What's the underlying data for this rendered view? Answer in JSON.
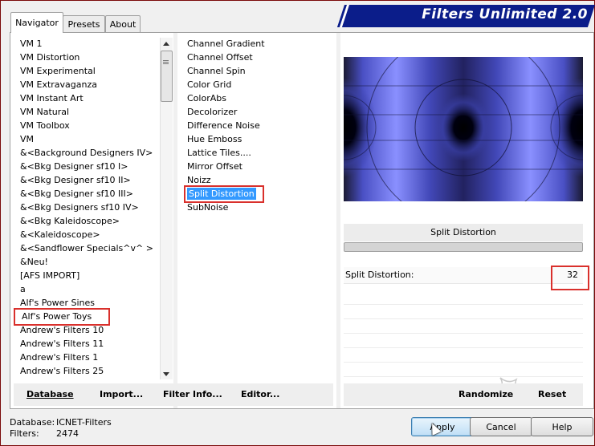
{
  "app": {
    "title": "Filters Unlimited 2.0",
    "brand_color": "#0b1d8a"
  },
  "tabs": [
    {
      "label": "Navigator",
      "active": true
    },
    {
      "label": "Presets",
      "active": false
    },
    {
      "label": "About",
      "active": false
    }
  ],
  "categories": {
    "items": [
      "VM 1",
      "VM Distortion",
      "VM Experimental",
      "VM Extravaganza",
      "VM Instant Art",
      "VM Natural",
      "VM Toolbox",
      "VM",
      "&<Background Designers IV>",
      "&<Bkg Designer sf10 I>",
      "&<Bkg Designer sf10 II>",
      "&<Bkg Designer sf10 III>",
      "&<Bkg Designers sf10 IV>",
      "&<Bkg Kaleidoscope>",
      "&<Kaleidoscope>",
      "&<Sandflower Specials^v^ >",
      "&Neu!",
      "[AFS IMPORT]",
      "a",
      "Alf's Power Sines",
      "Alf's Power Toys",
      "Andrew's Filters 10",
      "Andrew's Filters 11",
      "Andrew's Filters 1",
      "Andrew's Filters 25"
    ],
    "selected": "Alf's Power Toys"
  },
  "filters": {
    "items": [
      "Channel Gradient",
      "Channel Offset",
      "Channel Spin",
      "Color Grid",
      "ColorAbs",
      "Decolorizer",
      "Difference Noise",
      "Hue Emboss",
      "Lattice Tiles....",
      "Mirror Offset",
      "Noizz",
      "Split Distortion",
      "SubNoise"
    ],
    "selected": "Split Distortion"
  },
  "parameters": {
    "filter_name": "Split Distortion",
    "rows": [
      {
        "label": "Split Distortion:",
        "value": "32"
      }
    ]
  },
  "left_buttons": {
    "database": "Database",
    "import": "Import...",
    "filter_info": "Filter Info...",
    "editor": "Editor..."
  },
  "right_buttons": {
    "randomize": "Randomize",
    "reset": "Reset"
  },
  "status": {
    "database_label": "Database:",
    "database_value": "ICNET-Filters",
    "filters_label": "Filters:",
    "filters_value": "2474"
  },
  "dialog_buttons": {
    "apply": "Apply",
    "cancel": "Cancel",
    "help": "Help"
  },
  "colors": {
    "selection": "#3399ff",
    "highlight_box": "#d9302c",
    "preview_blue": "#5560dd"
  }
}
